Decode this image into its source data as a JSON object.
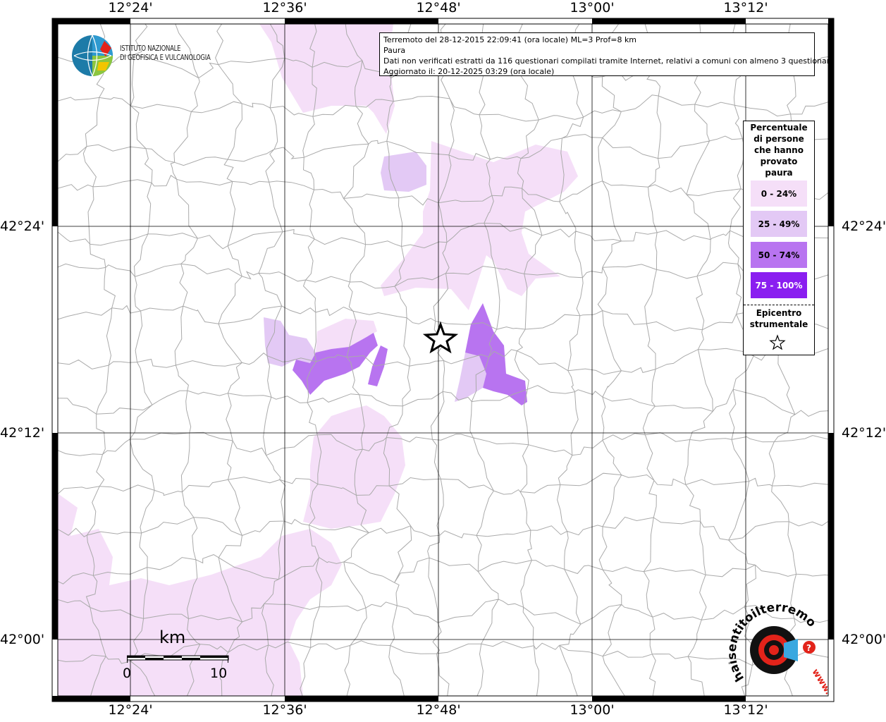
{
  "axes": {
    "top": [
      "12°24'",
      "12°36'",
      "12°48'",
      "13°00'",
      "13°12'"
    ],
    "bottom": [
      "12°24'",
      "12°36'",
      "12°48'",
      "13°00'",
      "13°12'"
    ],
    "left": [
      "42°24'",
      "42°12'",
      "42°00'"
    ],
    "right": [
      "42°24'",
      "42°12'",
      "42°00'"
    ]
  },
  "logo": {
    "line1": "ISTITUTO NAZIONALE",
    "line2": "DI GEOFISICA E VULCANOLOGIA"
  },
  "info": {
    "line1": "Terremoto del 28-12-2015 22:09:41 (ora locale) ML=3 Prof=8 km",
    "line2": "Paura",
    "line3": "Dati non verificati estratti da 116 questionari compilati tramite Internet, relativi a comuni con almeno 3 questionari.",
    "line4": "Aggiornato il: 20-12-2025 03:29 (ora locale)"
  },
  "legend": {
    "title_lines": [
      "Percentuale",
      "di persone",
      "che hanno",
      "provato",
      "paura"
    ],
    "classes": [
      {
        "label": "0 - 24%",
        "color": "#f5dff8",
        "text_color": "#000000"
      },
      {
        "label": "25 - 49%",
        "color": "#e3c9f5",
        "text_color": "#000000"
      },
      {
        "label": "50 - 74%",
        "color": "#b874f0",
        "text_color": "#000000"
      },
      {
        "label": "75 - 100%",
        "color": "#8a1ef0",
        "text_color": "#ffffff"
      }
    ],
    "epicenter_lines": [
      "Epicentro",
      "strumentale"
    ]
  },
  "scale": {
    "unit": "km",
    "min": "0",
    "max": "10"
  },
  "badge": {
    "text": "haisentitoilterremoto.it",
    "www": "www."
  },
  "colors": {
    "class0": "#f5dff8",
    "class1": "#e3c9f5",
    "class2": "#b874f0",
    "border": "#aaaaaa",
    "grid": "#000000",
    "accent_red": "#e2231a",
    "accent_blue": "#3aa8e0"
  }
}
